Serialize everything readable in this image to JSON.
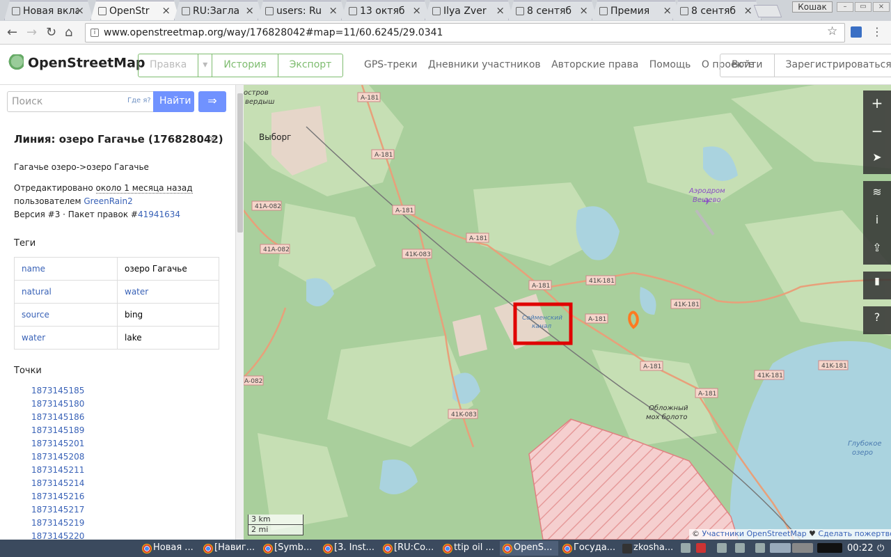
{
  "browser": {
    "tabs": [
      {
        "label": "Новая вкла",
        "active": false
      },
      {
        "label": "OpenStr",
        "active": true
      },
      {
        "label": "RU:Загла",
        "active": false
      },
      {
        "label": "users: Ru",
        "active": false
      },
      {
        "label": "13 октяб",
        "active": false
      },
      {
        "label": "Ilya Zver",
        "active": false
      },
      {
        "label": "8 сентяб",
        "active": false
      },
      {
        "label": "Премия",
        "active": false
      },
      {
        "label": "8 сентяб",
        "active": false
      }
    ],
    "window_user": "Кошак",
    "url": "www.openstreetmap.org/way/176828042#map=11/60.6245/29.0341"
  },
  "osm": {
    "logo_text": "OpenStreetMap",
    "edit_buttons": [
      "Правка",
      "История",
      "Экспорт"
    ],
    "nav_links": [
      "GPS-треки",
      "Дневники участников",
      "Авторские права",
      "Помощь",
      "О проекте"
    ],
    "login": "Войти",
    "signup": "Зарегистрироваться"
  },
  "sidebar": {
    "search_placeholder": "Поиск",
    "where_is": "Где я?",
    "find_button": "Найти",
    "feature_title": "Линия: озеро Гагачье (176828042)",
    "description": "Гагачье озеро->озеро Гагачье",
    "edited_prefix": "Отредактировано ",
    "edited_time": "около 1 месяца назад",
    "edited_by_prefix": "пользователем ",
    "edited_by_user": "GreenRain2",
    "version_prefix": "Версия #3 · Пакет правок #",
    "changeset": "41941634",
    "tags_heading": "Теги",
    "tags": [
      {
        "key": "name",
        "value": "озеро Гагачье"
      },
      {
        "key": "natural",
        "value": "water"
      },
      {
        "key": "source",
        "value": "bing"
      },
      {
        "key": "water",
        "value": "lake"
      }
    ],
    "nodes_heading": "Точки",
    "nodes": [
      "1873145185",
      "1873145180",
      "1873145186",
      "1873145189",
      "1873145201",
      "1873145208",
      "1873145211",
      "1873145214",
      "1873145216",
      "1873145217",
      "1873145219",
      "1873145220"
    ]
  },
  "map": {
    "labels": {
      "island": "остров",
      "island2": "вердыш",
      "vyborg": "Выборг",
      "airport1": "Аэродром",
      "airport2": "Вещево",
      "canal1": "Сайменский",
      "canal2": "канал",
      "swamp1": "Обложный",
      "swamp2": "мох болото",
      "lake1": "Глубокое",
      "lake2": "озеро"
    },
    "shields": [
      "A-181",
      "A-181",
      "A-181",
      "A-181",
      "A-181",
      "A-181",
      "A-181",
      "A-181",
      "41K-181",
      "41K-181",
      "41K-181",
      "41K-181",
      "41K-083",
      "41K-083",
      "41A-082",
      "41A-082",
      "A-082"
    ],
    "scale_km": "3 km",
    "scale_mi": "2 mi",
    "attribution_prefix": "© ",
    "attribution_link": "Участники OpenStreetMap",
    "donate_link": "Сделать пожертвование",
    "colors": {
      "forest": "#a9cf9c",
      "water": "#aad3df",
      "road": "#e8a07a",
      "highlight": "#e00000"
    }
  },
  "taskbar": {
    "tasks": [
      "Новая ...",
      "[Навиг...",
      "[Symb...",
      "[3. Inst...",
      "[RU:Co...",
      "ttip oil ...",
      "OpenS...",
      "Госуда...",
      "zkosha..."
    ],
    "clock": "00:22"
  }
}
